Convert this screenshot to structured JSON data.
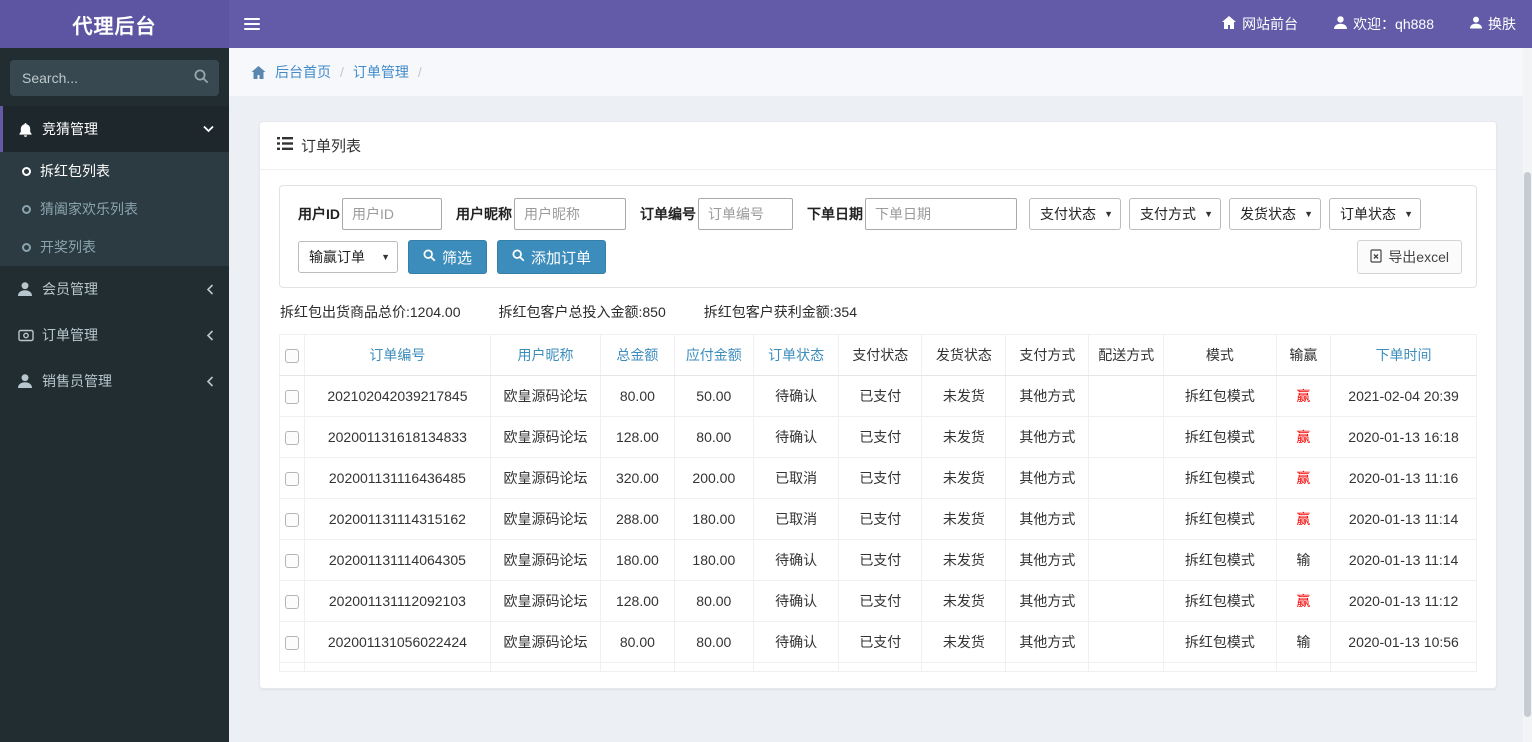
{
  "colors": {
    "accent_purple": "#635ba7",
    "link_blue": "#428bca",
    "header_link_blue": "#3c8dbc",
    "button_blue": "#3c8dbc",
    "win_red": "#f20000",
    "sidebar_dark": "#222d32"
  },
  "header": {
    "logo": "代理后台",
    "site_front": "网站前台",
    "welcome": "欢迎：qh888",
    "change_skin": "换肤"
  },
  "sidebar": {
    "search_placeholder": "Search...",
    "menu": [
      {
        "label": "竞猜管理",
        "icon": "bell-icon",
        "state": "expanded",
        "children": [
          {
            "label": "拆红包列表",
            "active": true
          },
          {
            "label": "猜阖家欢乐列表",
            "active": false
          },
          {
            "label": "开奖列表",
            "active": false
          }
        ]
      },
      {
        "label": "会员管理",
        "icon": "user-icon",
        "state": "collapsed"
      },
      {
        "label": "订单管理",
        "icon": "card-icon",
        "state": "collapsed"
      },
      {
        "label": "销售员管理",
        "icon": "user-icon",
        "state": "collapsed"
      }
    ]
  },
  "breadcrumb": {
    "home": "后台首页",
    "current": "订单管理",
    "separator": "/"
  },
  "panel": {
    "title": "订单列表"
  },
  "filters": {
    "user_id_label": "用户ID",
    "user_id_placeholder": "用户ID",
    "nickname_label": "用户昵称",
    "nickname_placeholder": "用户昵称",
    "order_no_label": "订单编号",
    "order_no_placeholder": "订单编号",
    "date_label": "下单日期",
    "date_placeholder": "下单日期",
    "pay_status_select": "支付状态",
    "pay_method_select": "支付方式",
    "ship_status_select": "发货状态",
    "order_status_select": "订单状态",
    "win_lose_select": "输赢订单",
    "filter_button": "筛选",
    "add_order_button": "添加订单",
    "export_button": "导出excel"
  },
  "stats": [
    {
      "text": "拆红包出货商品总价:1204.00"
    },
    {
      "text": "拆红包客户总投入金额:850"
    },
    {
      "text": "拆红包客户获利金额:354"
    }
  ],
  "table": {
    "columns": [
      {
        "key": "order_no",
        "label": "订单编号",
        "link": true
      },
      {
        "key": "nickname",
        "label": "用户昵称",
        "link": true
      },
      {
        "key": "total",
        "label": "总金额",
        "link": true
      },
      {
        "key": "payable",
        "label": "应付金额",
        "link": true
      },
      {
        "key": "order_status",
        "label": "订单状态",
        "link": true
      },
      {
        "key": "pay_status",
        "label": "支付状态",
        "link": false
      },
      {
        "key": "ship_status",
        "label": "发货状态",
        "link": false
      },
      {
        "key": "pay_method",
        "label": "支付方式",
        "link": false
      },
      {
        "key": "delivery",
        "label": "配送方式",
        "link": false
      },
      {
        "key": "mode",
        "label": "模式",
        "link": false
      },
      {
        "key": "result",
        "label": "输赢",
        "link": false
      },
      {
        "key": "time",
        "label": "下单时间",
        "link": true
      }
    ],
    "rows": [
      {
        "order_no": "202102042039217845",
        "nickname": "欧皇源码论坛",
        "total": "80.00",
        "payable": "50.00",
        "order_status": "待确认",
        "pay_status": "已支付",
        "ship_status": "未发货",
        "pay_method": "其他方式",
        "delivery": "",
        "mode": "拆红包模式",
        "result": "赢",
        "result_win": true,
        "time": "2021-02-04 20:39"
      },
      {
        "order_no": "202001131618134833",
        "nickname": "欧皇源码论坛",
        "total": "128.00",
        "payable": "80.00",
        "order_status": "待确认",
        "pay_status": "已支付",
        "ship_status": "未发货",
        "pay_method": "其他方式",
        "delivery": "",
        "mode": "拆红包模式",
        "result": "赢",
        "result_win": true,
        "time": "2020-01-13 16:18"
      },
      {
        "order_no": "202001131116436485",
        "nickname": "欧皇源码论坛",
        "total": "320.00",
        "payable": "200.00",
        "order_status": "已取消",
        "pay_status": "已支付",
        "ship_status": "未发货",
        "pay_method": "其他方式",
        "delivery": "",
        "mode": "拆红包模式",
        "result": "赢",
        "result_win": true,
        "time": "2020-01-13 11:16"
      },
      {
        "order_no": "202001131114315162",
        "nickname": "欧皇源码论坛",
        "total": "288.00",
        "payable": "180.00",
        "order_status": "已取消",
        "pay_status": "已支付",
        "ship_status": "未发货",
        "pay_method": "其他方式",
        "delivery": "",
        "mode": "拆红包模式",
        "result": "赢",
        "result_win": true,
        "time": "2020-01-13 11:14"
      },
      {
        "order_no": "202001131114064305",
        "nickname": "欧皇源码论坛",
        "total": "180.00",
        "payable": "180.00",
        "order_status": "待确认",
        "pay_status": "已支付",
        "ship_status": "未发货",
        "pay_method": "其他方式",
        "delivery": "",
        "mode": "拆红包模式",
        "result": "输",
        "result_win": false,
        "time": "2020-01-13 11:14"
      },
      {
        "order_no": "202001131112092103",
        "nickname": "欧皇源码论坛",
        "total": "128.00",
        "payable": "80.00",
        "order_status": "待确认",
        "pay_status": "已支付",
        "ship_status": "未发货",
        "pay_method": "其他方式",
        "delivery": "",
        "mode": "拆红包模式",
        "result": "赢",
        "result_win": true,
        "time": "2020-01-13 11:12"
      },
      {
        "order_no": "202001131056022424",
        "nickname": "欧皇源码论坛",
        "total": "80.00",
        "payable": "80.00",
        "order_status": "待确认",
        "pay_status": "已支付",
        "ship_status": "未发货",
        "pay_method": "其他方式",
        "delivery": "",
        "mode": "拆红包模式",
        "result": "输",
        "result_win": false,
        "time": "2020-01-13 10:56"
      }
    ]
  }
}
